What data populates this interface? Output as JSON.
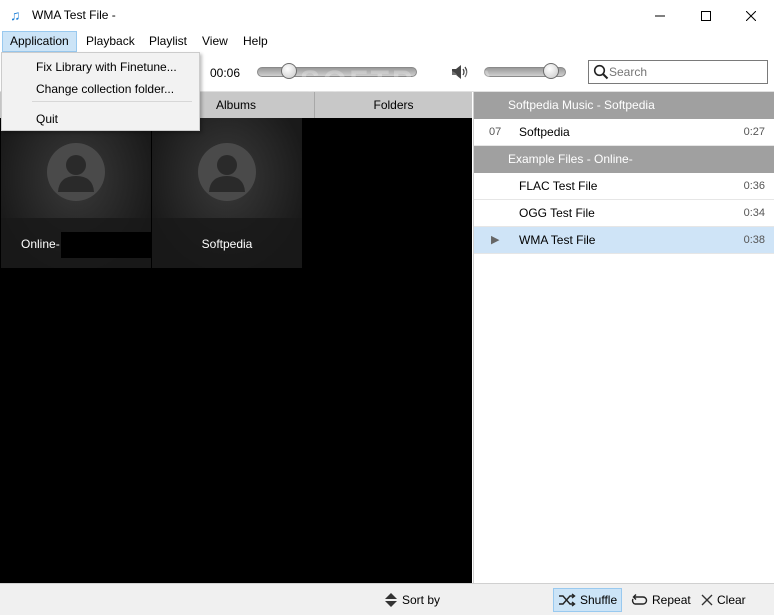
{
  "window": {
    "title": "WMA Test File -"
  },
  "menubar": {
    "items": [
      {
        "label": "Application"
      },
      {
        "label": "Playback"
      },
      {
        "label": "Playlist"
      },
      {
        "label": "View"
      },
      {
        "label": "Help"
      }
    ]
  },
  "app_menu": {
    "items": [
      {
        "label": "Fix Library with Finetune..."
      },
      {
        "label": "Change collection folder..."
      },
      {
        "label": "Quit"
      }
    ]
  },
  "toolbar": {
    "elapsed": "00:06",
    "seek_fraction": 0.17,
    "volume_fraction": 0.9,
    "search": {
      "placeholder": "Search",
      "value": ""
    }
  },
  "library": {
    "tabs": [
      {
        "label": ""
      },
      {
        "label": "Albums"
      },
      {
        "label": "Folders"
      }
    ],
    "tiles": [
      {
        "label": "Online-"
      },
      {
        "label": "Softpedia"
      }
    ]
  },
  "watermark": "SOFTPEDIA",
  "playlist": {
    "groups": [
      {
        "header": "Softpedia Music - Softpedia",
        "tracks": [
          {
            "number": "07",
            "title": "Softpedia",
            "duration": "0:27"
          }
        ]
      },
      {
        "header": "Example Files - Online-",
        "tracks": [
          {
            "number": "",
            "title": "FLAC Test File",
            "duration": "0:36"
          },
          {
            "number": "",
            "title": "OGG Test File",
            "duration": "0:34"
          },
          {
            "number": "",
            "title": "WMA Test File",
            "duration": "0:38",
            "playing": true
          }
        ]
      }
    ]
  },
  "bottombar": {
    "sort_label": "Sort by",
    "shuffle_label": "Shuffle",
    "repeat_label": "Repeat",
    "clear_label": "Clear"
  },
  "colors": {
    "selection": "#cfe4f7",
    "group_header": "#a0a0a0",
    "accent": "#1e7fd6"
  }
}
